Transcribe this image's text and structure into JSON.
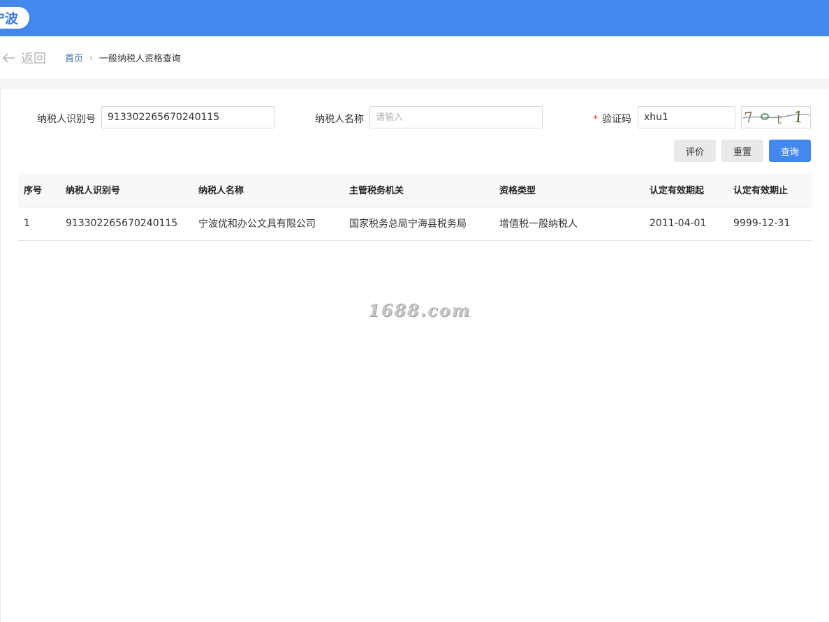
{
  "header": {
    "region_label": "宁波",
    "bg_color": "#4488ee"
  },
  "nav": {
    "back_label": "返回",
    "breadcrumb": {
      "home": "首页",
      "separator": "›",
      "current": "一般纳税人资格查询"
    }
  },
  "form": {
    "taxpayer_id": {
      "label": "纳税人识别号",
      "value": "913302265670240115"
    },
    "taxpayer_name": {
      "label": "纳税人名称",
      "value": "",
      "placeholder": "请输入"
    },
    "captcha": {
      "required_mark": "*",
      "label": "验证码",
      "value": "xhu1"
    },
    "buttons": {
      "evaluate": "评价",
      "reset": "重置",
      "query": "查询"
    }
  },
  "table": {
    "headers": [
      "序号",
      "纳税人识别号",
      "纳税人名称",
      "主管税务机关",
      "资格类型",
      "认定有效期起",
      "认定有效期止"
    ],
    "rows": [
      [
        "1",
        "913302265670240115",
        "宁波优和办公文具有限公司",
        "国家税务总局宁海县税务局",
        "增值税一般纳税人",
        "2011-04-01",
        "9999-12-31"
      ]
    ]
  },
  "watermark": "1688.com"
}
